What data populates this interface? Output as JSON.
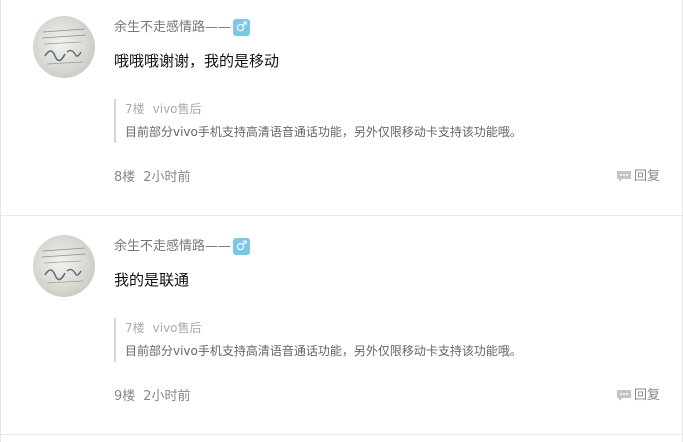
{
  "comments": [
    {
      "username": "余生不走感情路——",
      "gender_symbol": "♂",
      "content": "哦哦哦谢谢，我的是移动",
      "quote": {
        "floor": "7楼",
        "author": "vivo售后",
        "text": "目前部分vivo手机支持高清语音通话功能，另外仅限移动卡支持该功能哦。"
      },
      "floor": "8楼",
      "time": "2小时前",
      "reply_label": "回复"
    },
    {
      "username": "余生不走感情路——",
      "gender_symbol": "♂",
      "content": "我的是联通",
      "quote": {
        "floor": "7楼",
        "author": "vivo售后",
        "text": "目前部分vivo手机支持高清语音通话功能，另外仅限移动卡支持该功能哦。"
      },
      "floor": "9楼",
      "time": "2小时前",
      "reply_label": "回复"
    }
  ],
  "icons": {
    "gender": "male-icon",
    "reply": "comment-bubble-icon",
    "avatar": "user-avatar"
  },
  "colors": {
    "gender_badge": "#7cc6e6",
    "quote_border": "#d7d7d7",
    "divider": "#e9e9e9"
  }
}
